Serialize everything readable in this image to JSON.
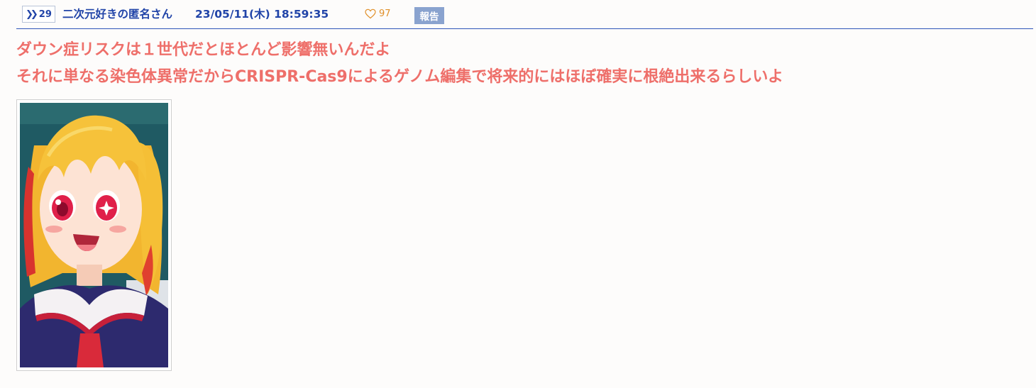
{
  "post": {
    "res_number": "29",
    "res_icon": "double-chevron-right-icon",
    "author": "二次元好きの匿名さん",
    "datetime": "23/05/11(木) 18:59:35",
    "like_icon": "heart-outline-icon",
    "like_count": "97",
    "report_label": "報告",
    "body_lines": [
      "ダウン症リスクは１世代だとほとんど影響無いんだよ",
      "それに単なる染色体異常だからCRISPR-Cas9によるゲノム編集で将来的にはほぼ確実に根絶出来るらしいよ"
    ],
    "image_icon": "anime-girl-image"
  },
  "colors": {
    "link_blue": "#2144a8",
    "body_text": "#ee6f6a",
    "like": "#e0902a",
    "report_bg": "#8aa3cf",
    "divider": "#2f55b8"
  }
}
